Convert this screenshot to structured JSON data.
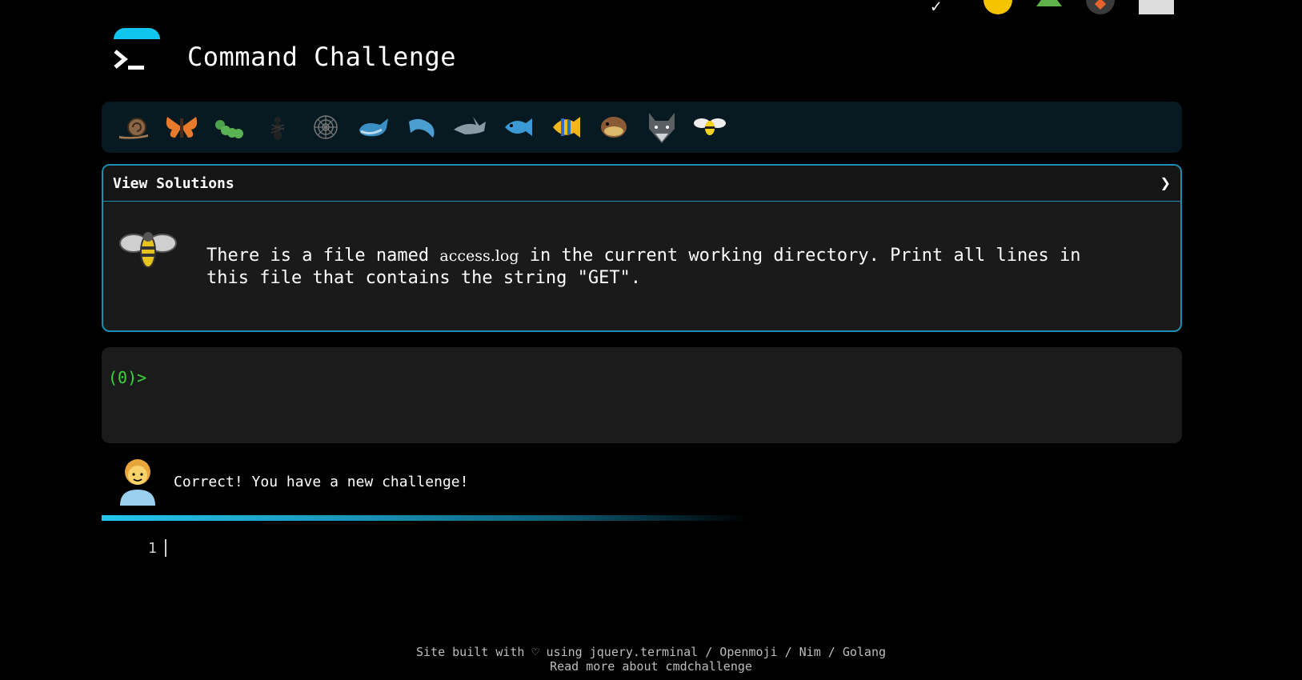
{
  "header": {
    "title": "Command Challenge"
  },
  "levels": [
    "snail-icon",
    "butterfly-icon",
    "caterpillar-icon",
    "ant-icon",
    "spider-web-icon",
    "whale-icon",
    "dolphin-icon",
    "shark-icon",
    "fish-icon",
    "tropical-fish-icon",
    "pufferfish-icon",
    "wolf-icon",
    "bee-icon"
  ],
  "solutions": {
    "label": "View Solutions",
    "toggle_icon": "chevron-right-icon"
  },
  "challenge": {
    "text_before": "There is a file named ",
    "filename": "access.log",
    "text_after": " in the current working directory. Print all lines in this file that contains the string \"GET\"."
  },
  "terminal": {
    "prompt": "(0)>"
  },
  "result": {
    "message": "Correct! You have a new challenge!"
  },
  "editor": {
    "line_number": "1"
  },
  "footer": {
    "line1": "Site built with ♡ using jquery.terminal / Openmoji / Nim / Golang",
    "line2": "Read more about cmdchallenge"
  },
  "colors": {
    "accent": "#1c8fb0",
    "prompt": "#3cd63c",
    "logo": "#10c5ee"
  }
}
